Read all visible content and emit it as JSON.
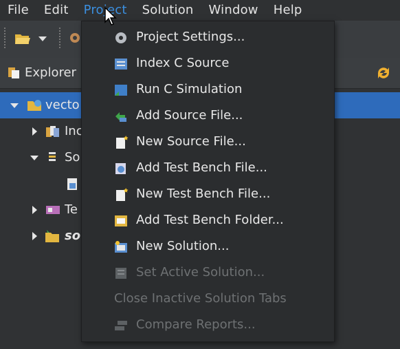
{
  "menubar": {
    "items": [
      {
        "label": "File"
      },
      {
        "label": "Edit"
      },
      {
        "label": "Project"
      },
      {
        "label": "Solution"
      },
      {
        "label": "Window"
      },
      {
        "label": "Help"
      }
    ]
  },
  "explorer": {
    "title": "Explorer",
    "tree": [
      {
        "label": "vecto",
        "icon": "project-icon"
      },
      {
        "label": "Inc",
        "icon": "includes-icon"
      },
      {
        "label": "So",
        "icon": "source-folder-icon"
      },
      {
        "label": "",
        "icon": "source-file-icon"
      },
      {
        "label": "Te",
        "icon": "testbench-icon"
      },
      {
        "label": "so",
        "icon": "solution-folder-icon"
      }
    ]
  },
  "project_menu": {
    "items": [
      {
        "label": "Project Settings...",
        "icon": "gear-icon",
        "enabled": true
      },
      {
        "label": "Index C Source",
        "icon": "index-icon",
        "enabled": true
      },
      {
        "label": "Run C Simulation",
        "icon": "simulation-icon",
        "enabled": true
      },
      {
        "label": "Add Source File...",
        "icon": "add-file-icon",
        "enabled": true
      },
      {
        "label": "New Source File...",
        "icon": "new-file-icon",
        "enabled": true
      },
      {
        "label": "Add Test Bench File...",
        "icon": "add-testbench-icon",
        "enabled": true
      },
      {
        "label": "New Test Bench File...",
        "icon": "new-testbench-icon",
        "enabled": true
      },
      {
        "label": "Add Test Bench Folder...",
        "icon": "add-folder-icon",
        "enabled": true
      },
      {
        "label": "New Solution...",
        "icon": "new-solution-icon",
        "enabled": true
      },
      {
        "label": "Set Active Solution...",
        "icon": "active-solution-icon",
        "enabled": false
      },
      {
        "label": "Close Inactive Solution Tabs",
        "icon": "",
        "enabled": false
      },
      {
        "label": "Compare Reports...",
        "icon": "compare-icon",
        "enabled": false
      }
    ]
  },
  "colors": {
    "accent": "#3b8fe0",
    "selection": "#2e6bbb",
    "menu_bg": "#2b2d2f"
  }
}
